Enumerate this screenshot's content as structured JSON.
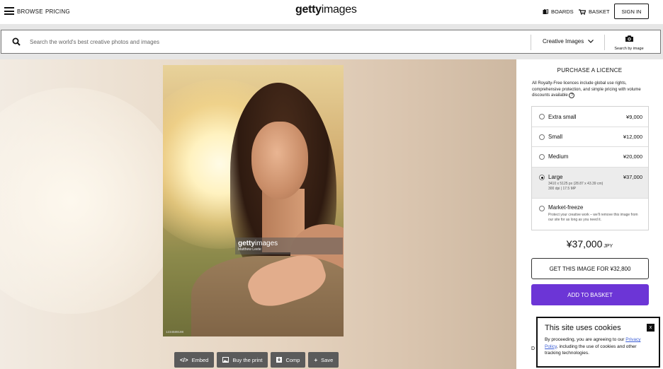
{
  "header": {
    "browse": "BROWSE",
    "pricing": "PRICING",
    "logo_bold": "getty",
    "logo_light": "images",
    "boards": "BOARDS",
    "basket": "BASKET",
    "sign_in": "SIGN IN"
  },
  "search": {
    "placeholder": "Search the world's best creative photos and images",
    "type_selected": "Creative Images",
    "camera_label": "Search by image"
  },
  "image": {
    "watermark_logo_bold": "getty",
    "watermark_logo_light": "images",
    "watermark_credit": "Matthew Leete",
    "image_id": "1234589198"
  },
  "toolbar": {
    "embed": "Embed",
    "buy_print": "Buy the print",
    "comp": "Comp",
    "save": "Save"
  },
  "panel": {
    "title": "PURCHASE A LICENCE",
    "note": "All Royalty-Free licences include global use rights, comprehensive protection, and simple pricing with volume discounts available",
    "options": [
      {
        "name": "Extra small",
        "price": "¥9,000",
        "selected": false
      },
      {
        "name": "Small",
        "price": "¥12,000",
        "selected": false
      },
      {
        "name": "Medium",
        "price": "¥20,000",
        "selected": false
      },
      {
        "name": "Large",
        "price": "¥37,000",
        "selected": true,
        "detail1": "3410 x 5125 px (28.87 x 43.39 cm)",
        "detail2": "300 dpi | 17.5 MP"
      },
      {
        "name": "Market-freeze",
        "price": "",
        "selected": false,
        "detail1": "Protect your creative work – we'll remove this image from our site for as long as you need it."
      }
    ],
    "price": "¥37,000",
    "currency": "JPY",
    "get_image_btn": "GET THIS IMAGE FOR ¥32,800",
    "add_basket_btn": "ADD TO BASKET",
    "peek_text": "D"
  },
  "cookie": {
    "title": "This site uses cookies",
    "text_before": "By proceeding, you are agreeing to our ",
    "link": "Privacy Policy",
    "text_after": ", including the use of cookies and other tracking technologies.",
    "close": "x"
  },
  "colors": {
    "primary": "#6c35d6",
    "tool_btn": "#5b5b5b"
  }
}
